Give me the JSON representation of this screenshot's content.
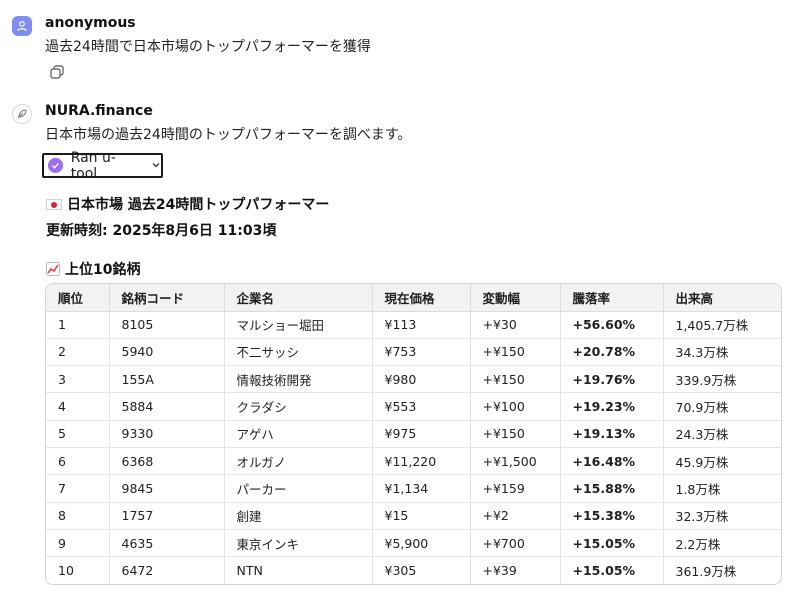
{
  "messages": {
    "user": {
      "author": "anonymous",
      "text": "過去24時間で日本市場のトップパフォーマーを獲得"
    },
    "assistant": {
      "author": "NURA.finance",
      "text": "日本市場の過去24時間のトップパフォーマーを調べます。",
      "tool_label": "Ran u-tool",
      "heading": "日本市場 過去24時間トップパフォーマー",
      "updated": "更新時刻: 2025年8月6日 11:03頃",
      "table_title": "上位10銘柄"
    }
  },
  "table": {
    "headers": [
      "順位",
      "銘柄コード",
      "企業名",
      "現在価格",
      "変動幅",
      "騰落率",
      "出来高"
    ],
    "rows": [
      [
        "1",
        "8105",
        "マルショー堀田",
        "¥113",
        "+¥30",
        "+56.60%",
        "1,405.7万株"
      ],
      [
        "2",
        "5940",
        "不二サッシ",
        "¥753",
        "+¥150",
        "+20.78%",
        "34.3万株"
      ],
      [
        "3",
        "155A",
        "情報技術開発",
        "¥980",
        "+¥150",
        "+19.76%",
        "339.9万株"
      ],
      [
        "4",
        "5884",
        "クラダシ",
        "¥553",
        "+¥100",
        "+19.23%",
        "70.9万株"
      ],
      [
        "5",
        "9330",
        "アゲハ",
        "¥975",
        "+¥150",
        "+19.13%",
        "24.3万株"
      ],
      [
        "6",
        "6368",
        "オルガノ",
        "¥11,220",
        "+¥1,500",
        "+16.48%",
        "45.9万株"
      ],
      [
        "7",
        "9845",
        "パーカー",
        "¥1,134",
        "+¥159",
        "+15.88%",
        "1.8万株"
      ],
      [
        "8",
        "1757",
        "創建",
        "¥15",
        "+¥2",
        "+15.38%",
        "32.3万株"
      ],
      [
        "9",
        "4635",
        "東京インキ",
        "¥5,900",
        "+¥700",
        "+15.05%",
        "2.2万株"
      ],
      [
        "10",
        "6472",
        "NTN",
        "¥305",
        "+¥39",
        "+15.05%",
        "361.9万株"
      ]
    ]
  },
  "icons": {
    "user_avatar": "user-icon",
    "bot_avatar": "feather-icon",
    "copy": "copy-icon",
    "tool_status": "check-circle-icon",
    "tool_toggle": "chevron-down-icon",
    "flag": "japan-flag-icon",
    "chart": "chart-increasing-icon"
  },
  "colors": {
    "user_avatar": "#7f8cf0",
    "tool_check": "#a06cf0",
    "flag_red": "#d7263d"
  }
}
